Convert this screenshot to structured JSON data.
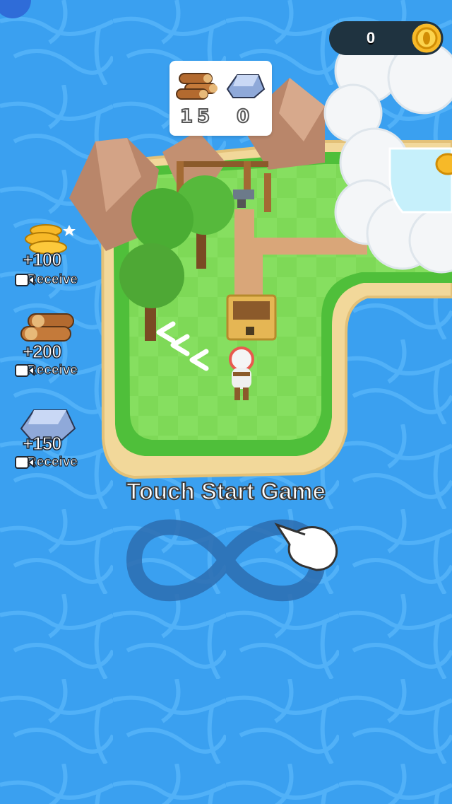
{
  "hud": {
    "coins": "0",
    "coin_icon": "gold-coin-icon"
  },
  "resources": [
    {
      "icon": "wood-logs-icon",
      "value": "15"
    },
    {
      "icon": "iron-ingot-icon",
      "value": "0"
    }
  ],
  "rewards": [
    {
      "icon": "gold-coins-icon",
      "amount": "+100",
      "label": "Receive"
    },
    {
      "icon": "wood-logs-icon",
      "amount": "+200",
      "label": "Receive"
    },
    {
      "icon": "iron-ingot-icon",
      "amount": "+150",
      "label": "Receive"
    }
  ],
  "prompt": {
    "text": "Touch Start Game",
    "gesture_icon": "infinity-swipe-icon",
    "hand_icon": "pointing-hand-icon"
  },
  "colors": {
    "water": "#3aa0f0",
    "grass": "#7ed957",
    "sand": "#f2d89a",
    "cloud": "#f4f6f8",
    "hud_bg": "#1f3340",
    "coin": "#f7b928"
  }
}
